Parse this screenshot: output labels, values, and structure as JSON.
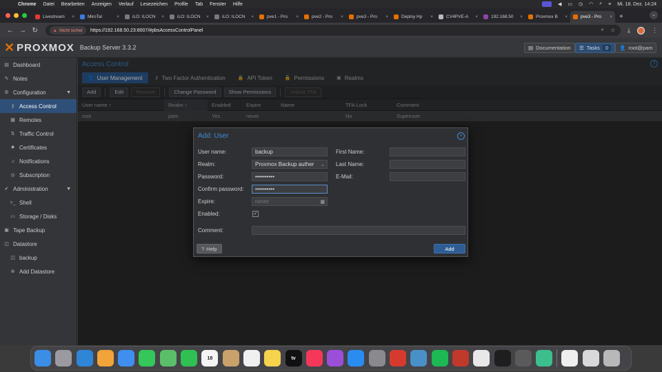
{
  "macos_menu": {
    "app": "Chrome",
    "items": [
      "Datei",
      "Bearbeiten",
      "Anzeigen",
      "Verlauf",
      "Lesezeichen",
      "Profile",
      "Tab",
      "Fenster",
      "Hilfe"
    ],
    "clock": "Mi. 18. Dez.  14:24"
  },
  "browser": {
    "tabs": [
      {
        "label": "Livestream",
        "color": "#e53935",
        "active": false
      },
      {
        "label": "MiroTal",
        "color": "#3d7be0",
        "active": false
      },
      {
        "label": "iLO: ILOCN",
        "color": "#7a7a7a",
        "active": false
      },
      {
        "label": "iLO: ILOCN",
        "color": "#7a7a7a",
        "active": false
      },
      {
        "label": "iLO: ILOCN",
        "color": "#7a7a7a",
        "active": false
      },
      {
        "label": "pve1 - Pro",
        "color": "#e57000",
        "active": false
      },
      {
        "label": "pve2 - Pro",
        "color": "#e57000",
        "active": false
      },
      {
        "label": "pve3 - Pro",
        "color": "#e57000",
        "active": false
      },
      {
        "label": "Deploy Hp",
        "color": "#e57000",
        "active": false
      },
      {
        "label": "CV4PVE-A",
        "color": "#bbbbbb",
        "active": false
      },
      {
        "label": "192.168.50",
        "color": "#8e44ad",
        "active": false
      },
      {
        "label": "Proxmox B",
        "color": "#e57000",
        "active": false
      },
      {
        "label": "pve3 - Pro",
        "color": "#e57000",
        "active": true
      }
    ],
    "not_secure": "Nicht sicher",
    "url": "https://192.168.50.23:8007/#pbsAccessControlPanel"
  },
  "header": {
    "logo_text": "PROXMOX",
    "product": "Backup Server 3.3.2",
    "documentation": "Documentation",
    "tasks": "Tasks",
    "tasks_count": "0",
    "user": "root@pam"
  },
  "sidebar": {
    "items": [
      {
        "label": "Dashboard",
        "icon": "dashboard-icon",
        "glyph": "▤",
        "sub": false,
        "selected": false
      },
      {
        "label": "Notes",
        "icon": "notes-icon",
        "glyph": "✎",
        "sub": false,
        "selected": false
      },
      {
        "label": "Configuration",
        "icon": "gears-icon",
        "glyph": "⚙",
        "sub": false,
        "selected": false,
        "expandable": true
      },
      {
        "label": "Access Control",
        "icon": "key-icon",
        "glyph": "⚷",
        "sub": true,
        "selected": true
      },
      {
        "label": "Remotes",
        "icon": "server-icon",
        "glyph": "▦",
        "sub": true,
        "selected": false
      },
      {
        "label": "Traffic Control",
        "icon": "signal-icon",
        "glyph": "⇅",
        "sub": true,
        "selected": false
      },
      {
        "label": "Certificates",
        "icon": "certificate-icon",
        "glyph": "✹",
        "sub": true,
        "selected": false
      },
      {
        "label": "Notifications",
        "icon": "bell-icon",
        "glyph": "♫",
        "sub": true,
        "selected": false
      },
      {
        "label": "Subscription",
        "icon": "support-icon",
        "glyph": "◎",
        "sub": true,
        "selected": false
      },
      {
        "label": "Administration",
        "icon": "wrench-icon",
        "glyph": "✔",
        "sub": false,
        "selected": false,
        "expandable": true
      },
      {
        "label": "Shell",
        "icon": "terminal-icon",
        "glyph": ">_",
        "sub": true,
        "selected": false
      },
      {
        "label": "Storage / Disks",
        "icon": "hdd-icon",
        "glyph": "▭",
        "sub": true,
        "selected": false
      },
      {
        "label": "Tape Backup",
        "icon": "tape-icon",
        "glyph": "▣",
        "sub": false,
        "selected": false
      },
      {
        "label": "Datastore",
        "icon": "database-icon",
        "glyph": "◫",
        "sub": false,
        "selected": false
      },
      {
        "label": "backup",
        "icon": "datastore-icon",
        "glyph": "◫",
        "sub": true,
        "selected": false
      },
      {
        "label": "Add Datastore",
        "icon": "plus-circle-icon",
        "glyph": "⊕",
        "sub": true,
        "selected": false
      }
    ]
  },
  "main": {
    "title": "Access Control",
    "tabs": [
      {
        "label": "User Management",
        "glyph": "👤",
        "active": true
      },
      {
        "label": "Two Factor Authentication",
        "glyph": "⚷",
        "active": false
      },
      {
        "label": "API Token",
        "glyph": "🔒",
        "active": false
      },
      {
        "label": "Permissions",
        "glyph": "🔓",
        "active": false
      },
      {
        "label": "Realms",
        "glyph": "▣",
        "active": false
      }
    ],
    "toolbar": {
      "add": "Add",
      "edit": "Edit",
      "remove": "Remove",
      "change_password": "Change Password",
      "show_permissions": "Show Permissions",
      "unlock_tfa": "Unlock TFA"
    },
    "columns": [
      "User name ↑",
      "Realm ↑",
      "Enabled",
      "Expire",
      "Name",
      "TFA Lock",
      "Comment"
    ],
    "rows": [
      [
        "root",
        "pam",
        "Yes",
        "never",
        "",
        "No",
        "Superuser"
      ]
    ]
  },
  "dialog": {
    "title": "Add: User",
    "labels": {
      "username": "User name:",
      "realm": "Realm:",
      "password": "Password:",
      "confirm": "Confirm password:",
      "expire": "Expire:",
      "enabled": "Enabled:",
      "comment": "Comment:",
      "firstname": "First Name:",
      "lastname": "Last Name:",
      "email": "E-Mail:"
    },
    "values": {
      "username": "backup",
      "realm": "Proxmox Backup auther",
      "password": "••••••••••",
      "confirm": "••••••••••",
      "expire_placeholder": "never",
      "enabled": true,
      "comment": "",
      "firstname": "",
      "lastname": "",
      "email": ""
    },
    "help": "Help",
    "add": "Add"
  },
  "dock": {
    "apps": [
      {
        "name": "finder-icon",
        "color": "#3a8ee6"
      },
      {
        "name": "launchpad-icon",
        "color": "#9a9aa0"
      },
      {
        "name": "safari-icon",
        "color": "#2f86d6"
      },
      {
        "name": "photos-icon",
        "color": "#f2a33a"
      },
      {
        "name": "mail-icon",
        "color": "#3f8ef0"
      },
      {
        "name": "messages-icon",
        "color": "#34c759"
      },
      {
        "name": "maps-icon",
        "color": "#5bbf6a"
      },
      {
        "name": "facetime-icon",
        "color": "#30c052"
      },
      {
        "name": "calendar-icon",
        "color": "#f4f4f4",
        "text": "18"
      },
      {
        "name": "contacts-icon",
        "color": "#c8a26a"
      },
      {
        "name": "reminders-icon",
        "color": "#f0f0f0"
      },
      {
        "name": "notes-app-icon",
        "color": "#f5d34c"
      },
      {
        "name": "appletv-icon",
        "color": "#111111",
        "text": "tv"
      },
      {
        "name": "music-icon",
        "color": "#f5385a"
      },
      {
        "name": "podcasts-icon",
        "color": "#9b4fd8"
      },
      {
        "name": "appstore-icon",
        "color": "#2a8cf0"
      },
      {
        "name": "settings-icon",
        "color": "#8a8a8e"
      },
      {
        "name": "tool-red-icon",
        "color": "#d63a2f"
      },
      {
        "name": "quicktime-icon",
        "color": "#4a90c8"
      },
      {
        "name": "spotify-icon",
        "color": "#1db954"
      },
      {
        "name": "app-red-icon",
        "color": "#c0392b"
      },
      {
        "name": "chrome-icon",
        "color": "#e8e8e8"
      },
      {
        "name": "terminal-icon",
        "color": "#1e1e1e"
      },
      {
        "name": "calculator-icon",
        "color": "#5a5a5a"
      },
      {
        "name": "sync-green-icon",
        "color": "#3cbf8c"
      },
      {
        "name": "document-icon",
        "color": "#efefef"
      },
      {
        "name": "preview-icon",
        "color": "#d8d8d8"
      },
      {
        "name": "trash-icon",
        "color": "#b8b8b8"
      }
    ]
  }
}
